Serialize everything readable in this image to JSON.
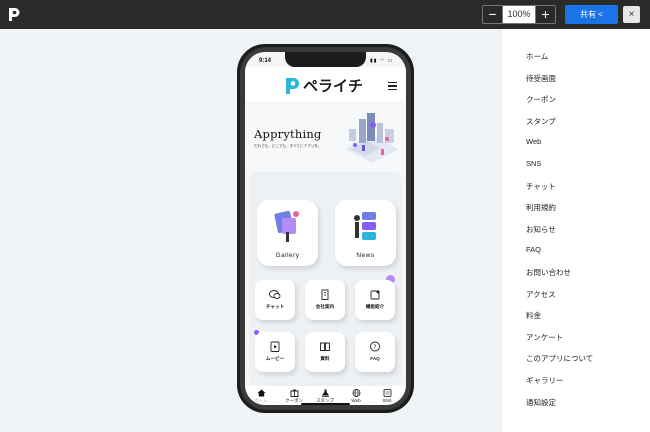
{
  "toolbar": {
    "zoom_out_label": "−",
    "zoom_value": "100%",
    "zoom_in_label": "+",
    "share_label": "共有 <",
    "close_label": "×"
  },
  "side_menu": {
    "items": [
      "ホーム",
      "待受画面",
      "クーポン",
      "スタンプ",
      "Web",
      "SNS",
      "チャット",
      "利用規約",
      "お知らせ",
      "FAQ",
      "お問い合わせ",
      "アクセス",
      "料金",
      "アンケート",
      "このアプリについて",
      "ギャラリー",
      "通知設定"
    ]
  },
  "phone": {
    "status_time": "9:14",
    "app_name": "ペライチ",
    "hero_title": "Apprything",
    "hero_subtitle": "だれでも、どこでも、すべてにアプリを。",
    "big_cards": [
      "Gallery",
      "News"
    ],
    "small_cards": [
      "チャット",
      "会社案内",
      "機能紹介",
      "ムービー",
      "資料",
      "FAQ"
    ],
    "tabs": [
      "ホーム",
      "クーポン",
      "スタンプ",
      "Web",
      "SNS"
    ]
  },
  "colors": {
    "accent": "#1a74e8",
    "brand": "#29b6d8",
    "topbar": "#2a2a2a",
    "illustration_purple": "#8a5cf6"
  }
}
